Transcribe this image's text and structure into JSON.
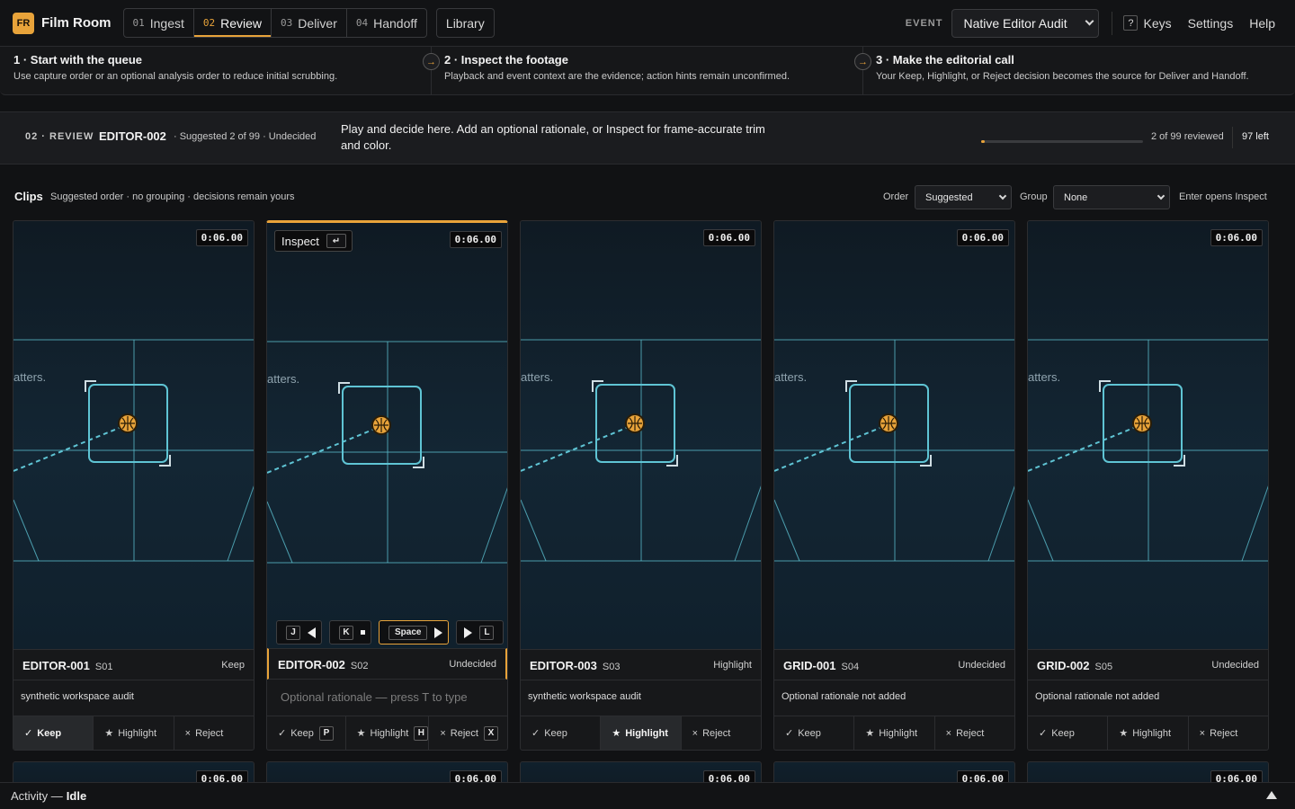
{
  "brand": {
    "logo": "FR",
    "name": "Film Room"
  },
  "stages": [
    {
      "num": "01",
      "label": "Ingest"
    },
    {
      "num": "02",
      "label": "Review"
    },
    {
      "num": "03",
      "label": "Deliver"
    },
    {
      "num": "04",
      "label": "Handoff"
    }
  ],
  "library_label": "Library",
  "event": {
    "label": "EVENT",
    "value": "Native Editor Audit"
  },
  "keys": {
    "kbd": "?",
    "label": "Keys"
  },
  "settings_label": "Settings",
  "help_label": "Help",
  "steps": [
    {
      "title": "1 · Start with the queue",
      "desc": "Use capture order or an optional analysis order to reduce initial scrubbing."
    },
    {
      "title": "2 · Inspect the footage",
      "desc": "Playback and event context are the evidence; action hints remain unconfirmed."
    },
    {
      "title": "3 · Make the editorial call",
      "desc": "Your Keep, Highlight, or Reject decision becomes the source for Deliver and Handoff."
    }
  ],
  "review_bar": {
    "stage": "02 · REVIEW",
    "clip": "EDITOR-002",
    "meta": "· Suggested 2 of 99 · Undecided",
    "instruction": "Play and decide here. Add an optional rationale, or Inspect for frame-accurate trim and color.",
    "progress": 0.02,
    "reviewed": "2 of 99 reviewed",
    "left": "97 left"
  },
  "clips_header": {
    "title": "Clips",
    "subtitle": "Suggested order · no grouping · decisions remain yours",
    "order_label": "Order",
    "order_value": "Suggested",
    "group_label": "Group",
    "group_value": "None",
    "enter_hint": "Enter opens Inspect"
  },
  "thumb_overlay_text": "atters.",
  "cards": [
    {
      "name": "EDITOR-001",
      "scene": "S01",
      "decision": "Keep",
      "duration": "0:06.00",
      "rationale": "synthetic workspace audit",
      "active": "keep"
    },
    {
      "name": "EDITOR-002",
      "scene": "S02",
      "decision": "Undecided",
      "duration": "0:06.00",
      "rationale": "Optional rationale — press T to type",
      "active": ""
    },
    {
      "name": "EDITOR-003",
      "scene": "S03",
      "decision": "Highlight",
      "duration": "0:06.00",
      "rationale": "synthetic workspace audit",
      "active": "highlight"
    },
    {
      "name": "GRID-001",
      "scene": "S04",
      "decision": "Undecided",
      "duration": "0:06.00",
      "rationale": "Optional rationale not added",
      "active": ""
    },
    {
      "name": "GRID-002",
      "scene": "S05",
      "decision": "Undecided",
      "duration": "0:06.00",
      "rationale": "Optional rationale not added",
      "active": ""
    }
  ],
  "actions": {
    "keep": "Keep",
    "highlight": "Highlight",
    "reject": "Reject",
    "keep_kbd": "P",
    "highlight_kbd": "H",
    "reject_kbd": "X"
  },
  "glyphs": {
    "keep": "✓",
    "highlight": "★",
    "reject": "×"
  },
  "inspect": {
    "label": "Inspect",
    "kbd": "↵"
  },
  "transport": {
    "back": "J",
    "stop": "K",
    "play": "Space",
    "forward": "L"
  },
  "peek_durations": [
    "0:06.00",
    "0:06.00",
    "0:06.00",
    "0:06.00",
    "0:06.00"
  ],
  "activity": {
    "label": "Activity —",
    "status": "Idle"
  },
  "colors": {
    "accent": "#e8a33a",
    "overlay": "#5fc4d4",
    "background": "#111214"
  }
}
